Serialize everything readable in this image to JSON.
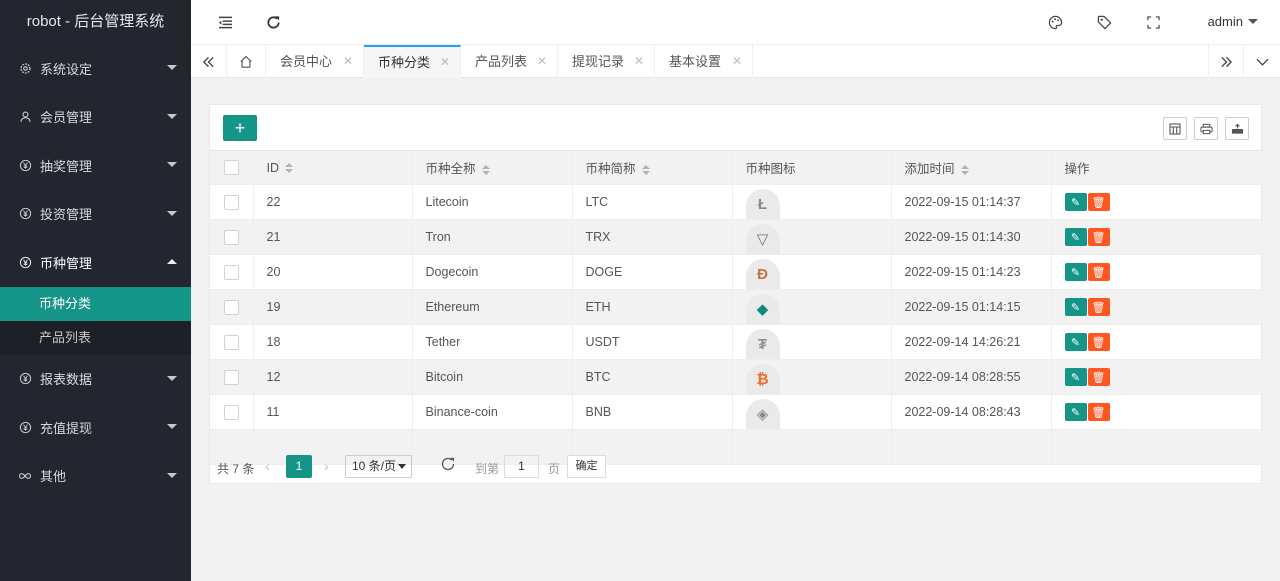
{
  "app_title": "robot - 后台管理系统",
  "sidebar": {
    "items": [
      {
        "label": "系统设定"
      },
      {
        "label": "会员管理"
      },
      {
        "label": "抽奖管理"
      },
      {
        "label": "投资管理"
      },
      {
        "label": "币种管理"
      },
      {
        "label": "报表数据"
      },
      {
        "label": "充值提现"
      },
      {
        "label": "其他"
      }
    ],
    "sub_items": [
      {
        "label": "币种分类"
      },
      {
        "label": "产品列表"
      }
    ]
  },
  "header": {
    "user": "admin"
  },
  "tabs": [
    {
      "label": "会员中心"
    },
    {
      "label": "币种分类"
    },
    {
      "label": "产品列表"
    },
    {
      "label": "提现记录"
    },
    {
      "label": "基本设置"
    }
  ],
  "toolbar": {
    "add_label": "+"
  },
  "table": {
    "headers": [
      "ID",
      "币种全称",
      "币种简称",
      "币种图标",
      "添加时间",
      "操作"
    ],
    "rows": [
      {
        "id": "22",
        "name": "Litecoin",
        "symbol": "LTC",
        "icon": "Ł",
        "icon_color": "#8c8c8c",
        "time": "2022-09-15 01:14:37"
      },
      {
        "id": "21",
        "name": "Tron",
        "symbol": "TRX",
        "icon": "▽",
        "icon_color": "#777777",
        "time": "2022-09-15 01:14:30"
      },
      {
        "id": "20",
        "name": "Dogecoin",
        "symbol": "DOGE",
        "icon": "Ð",
        "icon_color": "#c2733c",
        "time": "2022-09-15 01:14:23"
      },
      {
        "id": "19",
        "name": "Ethereum",
        "symbol": "ETH",
        "icon": "◆",
        "icon_color": "#0f8a7a",
        "time": "2022-09-15 01:14:15"
      },
      {
        "id": "18",
        "name": "Tether",
        "symbol": "USDT",
        "icon": "₮",
        "icon_color": "#909090",
        "time": "2022-09-14 14:26:21"
      },
      {
        "id": "12",
        "name": "Bitcoin",
        "symbol": "BTC",
        "icon": "₿",
        "icon_color": "#f26b21",
        "time": "2022-09-14 08:28:55"
      },
      {
        "id": "11",
        "name": "Binance-coin",
        "symbol": "BNB",
        "icon": "◈",
        "icon_color": "#8a8a8a",
        "time": "2022-09-14 08:28:43"
      }
    ]
  },
  "pager": {
    "total": "共 7 条",
    "current": "1",
    "page_size": "10 条/页",
    "goto_label": "到第",
    "goto_value": "1",
    "page_label": "页",
    "confirm": "确定"
  },
  "colors": {
    "accent": "#159488",
    "danger": "#ff5722",
    "sidebar_bg": "#23262e"
  }
}
